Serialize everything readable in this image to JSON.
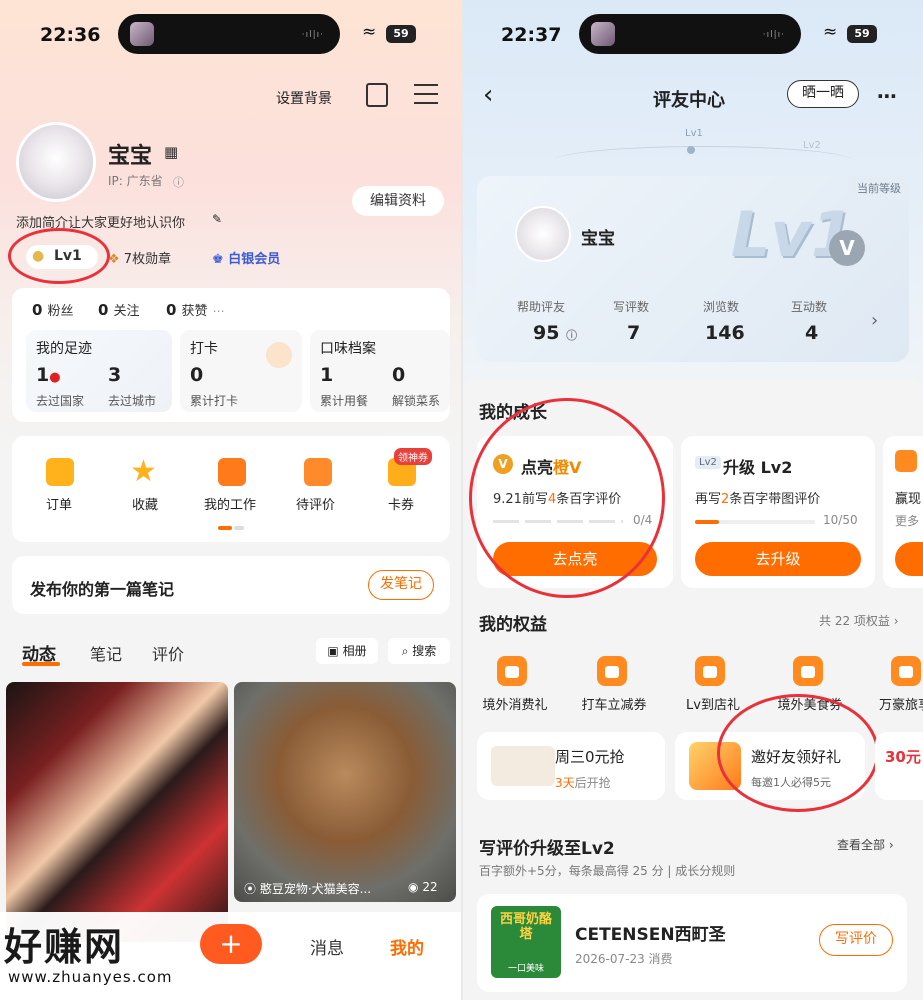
{
  "left": {
    "status": {
      "time": "22:36",
      "battery": "59"
    },
    "header": {
      "set_bg": "设置背景"
    },
    "profile": {
      "name": "宝宝",
      "ip": "IP: 广东省",
      "bio": "添加简介让大家更好地认识你",
      "edit": "编辑资料",
      "level": "Lv1",
      "medals": "7枚勋章",
      "member": "白银会员"
    },
    "social": {
      "fans_num": "0",
      "fans": "粉丝",
      "follow_num": "0",
      "follow": "关注",
      "likes_num": "0",
      "likes": "获赞"
    },
    "footprint": {
      "title": "我的足迹",
      "country_num": "1",
      "country": "去过国家",
      "city_num": "3",
      "city": "去过城市"
    },
    "checkin": {
      "title": "打卡",
      "num": "0",
      "label": "累计打卡"
    },
    "taste": {
      "title": "口味档案",
      "meals_num": "1",
      "meals": "累计用餐",
      "dishes_num": "0",
      "dishes": "解锁菜系"
    },
    "shortcuts": [
      {
        "label": "订单"
      },
      {
        "label": "收藏"
      },
      {
        "label": "我的工作"
      },
      {
        "label": "待评价"
      },
      {
        "label": "卡券",
        "badge": "领神券"
      }
    ],
    "post": {
      "title": "发布你的第一篇笔记",
      "button": "发笔记"
    },
    "tabs": {
      "t1": "动态",
      "t2": "笔记",
      "t3": "评价",
      "album": "相册",
      "search": "搜索"
    },
    "feed": {
      "caption": "憨豆宠物·犬猫美容...",
      "views": "22"
    },
    "bottom": {
      "plus": "+",
      "msg": "消息",
      "mine": "我的"
    },
    "watermark": {
      "main": "好赚网",
      "url": "www.zhuanyes.com"
    }
  },
  "right": {
    "status": {
      "time": "22:37",
      "battery": "59"
    },
    "header": {
      "title": "评友中心",
      "share": "晒一晒"
    },
    "levelbar": {
      "lv1": "Lv1",
      "lv2": "Lv2"
    },
    "card": {
      "current": "当前等级",
      "name": "宝宝",
      "lv_big": "Lv1",
      "v": "V",
      "stats": [
        {
          "label": "帮助评友",
          "value": "95"
        },
        {
          "label": "写评数",
          "value": "7"
        },
        {
          "label": "浏览数",
          "value": "146"
        },
        {
          "label": "互动数",
          "value": "4"
        }
      ]
    },
    "growth": {
      "title": "我的成长",
      "c1": {
        "title_a": "点亮",
        "title_b": "橙V",
        "desc_a": "9.21前写",
        "desc_num": "4",
        "desc_b": "条百字评价",
        "progress": "0/4",
        "button": "去点亮"
      },
      "c2": {
        "tag": "Lv2",
        "title": "升级 Lv2",
        "desc_a": "再写",
        "desc_num": "2",
        "desc_b": "条百字带图评价",
        "progress": "10/50",
        "button": "去升级"
      },
      "c3": {
        "title": "赢现",
        "desc": "更多"
      }
    },
    "rights": {
      "title": "我的权益",
      "count": "共 22 项权益",
      "items": [
        {
          "label": "境外消费礼"
        },
        {
          "label": "打车立减券"
        },
        {
          "label": "Lv到店礼"
        },
        {
          "label": "境外美食券"
        },
        {
          "label": "万豪旅享"
        }
      ],
      "promo1": {
        "title": "周三0元抢",
        "sub_a": "3天",
        "sub_b": "后开抢"
      },
      "promo2": {
        "title": "邀好友领好礼",
        "sub": "每邀1人必得5元"
      },
      "promo3": {
        "title": "30元"
      }
    },
    "review": {
      "title": "写评价升级至Lv2",
      "view_all": "查看全部",
      "desc": "百字额外+5分，每条最高得 25 分 | 成长分规则",
      "shop": "CETENSEN西町圣",
      "date": "2026-07-23 消费",
      "button": "写评价",
      "logo_text": "西哥奶酪塔",
      "logo_sub": "一口美味"
    }
  },
  "colors": {
    "accent": "#ff6d00",
    "annotation": "#e8313b"
  }
}
